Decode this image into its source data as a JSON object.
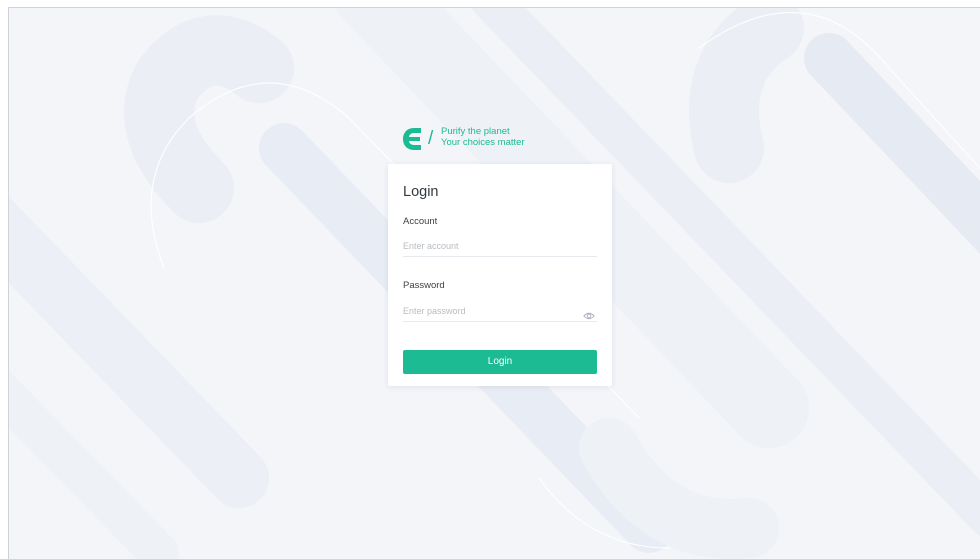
{
  "brand": {
    "tagline_line1": "Purify the planet",
    "tagline_line2": "Your choices matter",
    "slash": "/",
    "logo_icon": "e-leaf-logo",
    "color": "#1cbb93"
  },
  "login": {
    "title": "Login",
    "account_label": "Account",
    "account_placeholder": "Enter account",
    "account_value": "",
    "password_label": "Password",
    "password_placeholder": "Enter password",
    "password_value": "",
    "password_toggle_icon": "eye-icon",
    "submit_label": "Login"
  },
  "colors": {
    "accent": "#1cbb93",
    "background": "#f3f5f9",
    "card": "#ffffff"
  }
}
